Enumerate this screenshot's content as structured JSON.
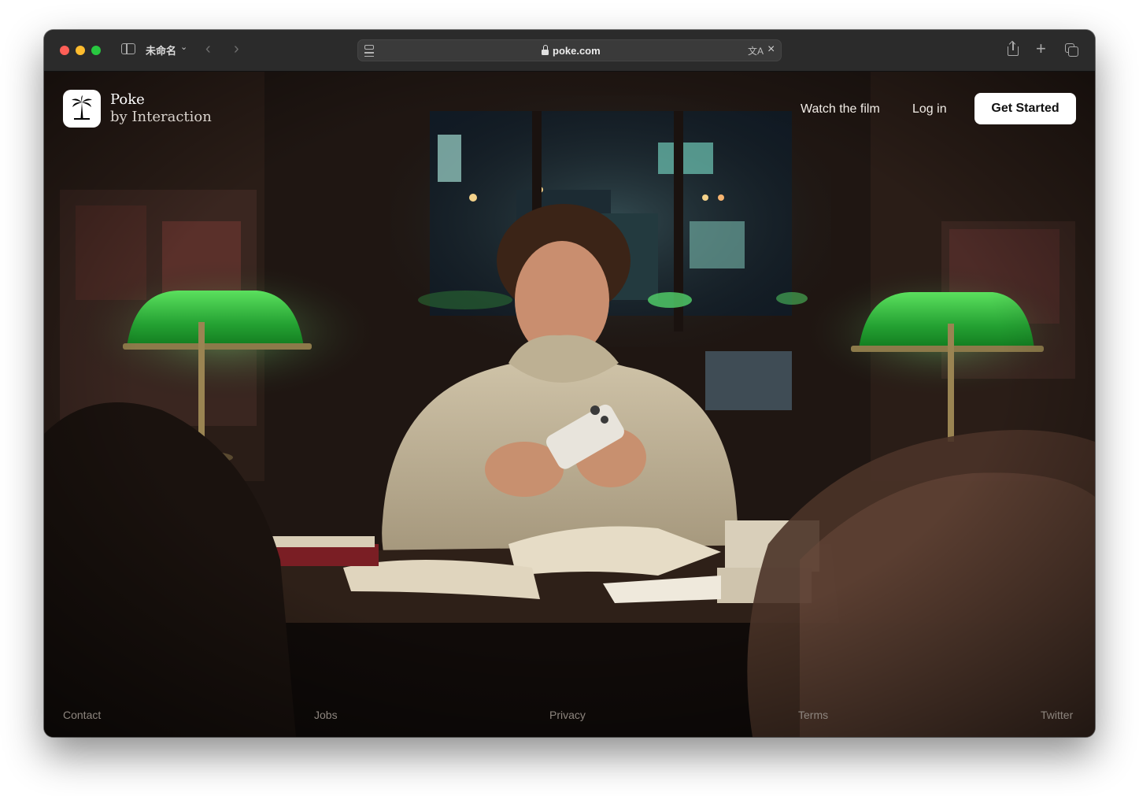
{
  "browser": {
    "tab_group_title": "未命名",
    "url": "poke.com"
  },
  "site": {
    "brand_name": "Poke",
    "brand_tagline": "by Interaction",
    "nav": {
      "watch_film": "Watch the film",
      "login": "Log in",
      "get_started": "Get Started"
    },
    "footer": {
      "contact": "Contact",
      "jobs": "Jobs",
      "privacy": "Privacy",
      "terms": "Terms",
      "twitter": "Twitter"
    }
  },
  "colors": {
    "lamp_green": "#2fae3c",
    "toolbar_bg": "#2b2b2b",
    "cta_bg": "#ffffff"
  },
  "icons": {
    "logo": "palm-tree-icon",
    "lock": "lock-icon",
    "translate": "translate-icon"
  }
}
